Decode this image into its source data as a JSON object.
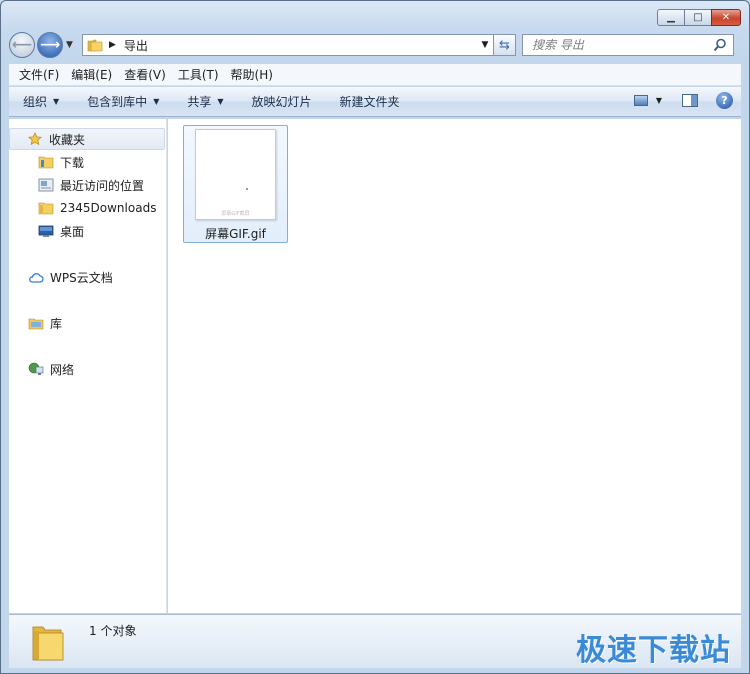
{
  "window": {
    "min_icon": "minimize-icon",
    "max_icon": "maximize-icon",
    "close_icon": "close-icon"
  },
  "address": {
    "breadcrumb": "导出",
    "search_placeholder": "搜索 导出"
  },
  "menu": [
    "文件(F)",
    "编辑(E)",
    "查看(V)",
    "工具(T)",
    "帮助(H)"
  ],
  "commands": {
    "organize": "组织",
    "include_in_library": "包含到库中",
    "share": "共享",
    "slideshow": "放映幻灯片",
    "new_folder": "新建文件夹"
  },
  "nav": {
    "favorites": "收藏夹",
    "downloads": "下载",
    "recent": "最近访问的位置",
    "downloads2345": "2345Downloads",
    "desktop": "桌面",
    "wps": "WPS云文档",
    "library": "库",
    "network": "网络"
  },
  "files": [
    {
      "name": "屏幕GIF.gif",
      "thumb_caption": "屏幕GIF截屏"
    }
  ],
  "status": {
    "count_text": "1 个对象",
    "watermark": "极速下载站"
  },
  "colors": {
    "accent": "#2358a8",
    "watermark": "#3a8ad6",
    "selection": "#84acdd"
  }
}
